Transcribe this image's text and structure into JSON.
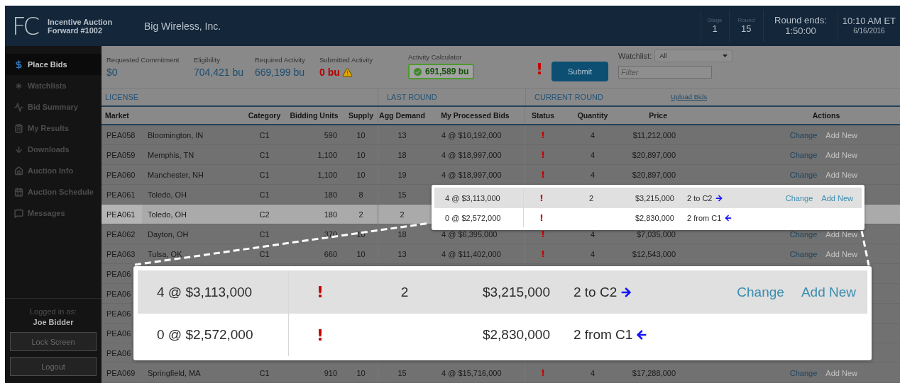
{
  "header": {
    "logo": "FC",
    "auction_title": "Incentive Auction",
    "auction_subtitle": "Forward #1002",
    "bidder": "Big Wireless, Inc.",
    "stage": {
      "label": "Stage",
      "value": "1"
    },
    "round": {
      "label": "Round",
      "value": "15"
    },
    "round_ends": {
      "label": "Round ends:",
      "value": "1:50:00"
    },
    "clock": {
      "time": "10:10 AM ET",
      "date": "6/16/2016"
    }
  },
  "sidebar": {
    "items": [
      {
        "label": "Place Bids",
        "selected": true
      },
      {
        "label": "Watchlists",
        "selected": false
      },
      {
        "label": "Bid Summary",
        "selected": false
      },
      {
        "label": "My Results",
        "selected": false
      },
      {
        "label": "Downloads",
        "selected": false
      },
      {
        "label": "Auction Info",
        "selected": false
      },
      {
        "label": "Auction Schedule",
        "selected": false
      },
      {
        "label": "Messages",
        "selected": false
      }
    ],
    "user": {
      "label": "Logged in as:",
      "name": "Joe Bidder"
    },
    "buttons": [
      "Lock Screen",
      "Logout"
    ]
  },
  "summary": {
    "metrics": [
      {
        "label": "Requested Commitment",
        "value": "$0",
        "kind": "plain"
      },
      {
        "label": "Eligibility",
        "value": "704,421 bu",
        "kind": "plain"
      },
      {
        "label": "Required Activity",
        "value": "669,199 bu",
        "kind": "plain"
      },
      {
        "label": "Submitted Activity",
        "value": "0 bu",
        "kind": "alert"
      }
    ],
    "calculator": {
      "label": "Activity Calculator",
      "value": "691,589 bu"
    },
    "alert_mark": "!",
    "submit": "Submit",
    "watchlist": {
      "label": "Watchlist:",
      "value": "All"
    },
    "filter": {
      "placeholder": "Filter"
    }
  },
  "table": {
    "groups": [
      {
        "label": "LICENSE"
      },
      {
        "label": "LAST ROUND"
      },
      {
        "label": "CURRENT ROUND",
        "link": "Upload Bids"
      }
    ],
    "columns": [
      "Market",
      "Category",
      "Bidding Units",
      "Supply",
      "Agg Demand",
      "My Processed Bids",
      "Status",
      "Quantity",
      "Price",
      "Actions"
    ],
    "rows": [
      {
        "code": "PEA058",
        "name": "Bloomington, IN",
        "category": "C1",
        "units": "590",
        "supply": "10",
        "demand": "13",
        "bids": "4 @ $10,192,000",
        "status": "!",
        "quantity": "4",
        "price": "$11,212,000",
        "change": "Change",
        "add_new": {
          "label": "Add New",
          "disabled": true
        },
        "selected": false
      },
      {
        "code": "PEA059",
        "name": "Memphis, TN",
        "category": "C1",
        "units": "1,100",
        "supply": "10",
        "demand": "18",
        "bids": "4 @ $18,997,000",
        "status": "!",
        "quantity": "4",
        "price": "$20,897,000",
        "change": "Change",
        "add_new": {
          "label": "Add New",
          "disabled": true
        },
        "selected": false
      },
      {
        "code": "PEA060",
        "name": "Manchester, NH",
        "category": "C1",
        "units": "1,100",
        "supply": "10",
        "demand": "19",
        "bids": "4 @ $18,997,000",
        "status": "!",
        "quantity": "4",
        "price": "$20,897,000",
        "change": "Change",
        "add_new": {
          "label": "Add New",
          "disabled": true
        },
        "selected": false
      },
      {
        "code": "PEA061",
        "name": "Toledo, OH",
        "category": "C1",
        "units": "180",
        "supply": "8",
        "demand": "15",
        "selected": false
      },
      {
        "code": "PEA061",
        "name": "Toledo, OH",
        "category": "C2",
        "units": "180",
        "supply": "2",
        "demand": "2",
        "selected": true
      },
      {
        "code": "PEA062",
        "name": "Dayton, OH",
        "category": "C1",
        "units": "370",
        "supply": "10",
        "demand": "18",
        "bids": "4 @ $6,395,000",
        "status": "!",
        "quantity": "4",
        "price": "$7,035,000",
        "change": "Change",
        "add_new": {
          "label": "Add New",
          "disabled": true
        },
        "selected": false
      },
      {
        "code": "PEA063",
        "name": "Tulsa, OK",
        "category": "C1",
        "units": "660",
        "supply": "10",
        "demand": "13",
        "bids": "4 @ $11,402,000",
        "status": "!",
        "quantity": "4",
        "price": "$12,543,000",
        "change": "Change",
        "add_new": {
          "label": "Add New",
          "disabled": true
        },
        "selected": false
      },
      {
        "code": "PEA06",
        "selected": false
      },
      {
        "code": "PEA06",
        "selected": false
      },
      {
        "code": "PEA06",
        "selected": false
      },
      {
        "code": "PEA06",
        "selected": false
      },
      {
        "code": "PEA06",
        "selected": false
      },
      {
        "code": "PEA069",
        "name": "Springfield, MA",
        "category": "C1",
        "units": "910",
        "supply": "10",
        "demand": "15",
        "bids": "4 @ $15,716,000",
        "status": "!",
        "quantity": "4",
        "price": "$17,288,000",
        "change": "Change",
        "add_new": {
          "label": "Add New",
          "disabled": true
        },
        "selected": false
      }
    ]
  },
  "inset_callout": {
    "rows": [
      {
        "kind": "outgoing",
        "bids": "4 @ $3,113,000",
        "status": "!",
        "quantity": "2",
        "price": "$3,215,000",
        "transfer": "2 to C2",
        "change": "Change",
        "add_new": {
          "label": "Add New",
          "disabled": false
        },
        "selected": false
      },
      {
        "kind": "incoming",
        "bids": "0 @ $2,572,000",
        "status": "!",
        "price": "$2,830,000",
        "transfer": "2 from C1",
        "selected": true
      }
    ]
  },
  "magnified_callout": {
    "rows": [
      {
        "kind": "outgoing",
        "bids": "4 @ $3,113,000",
        "status": "!",
        "quantity": "2",
        "price": "$3,215,000",
        "transfer": "2 to C2",
        "change": "Change",
        "add_new": {
          "label": "Add New",
          "disabled": false
        },
        "selected": false
      },
      {
        "kind": "incoming",
        "bids": "0 @ $2,572,000",
        "status": "!",
        "price": "$2,830,000",
        "transfer": "2 from C1",
        "selected": true
      }
    ]
  }
}
